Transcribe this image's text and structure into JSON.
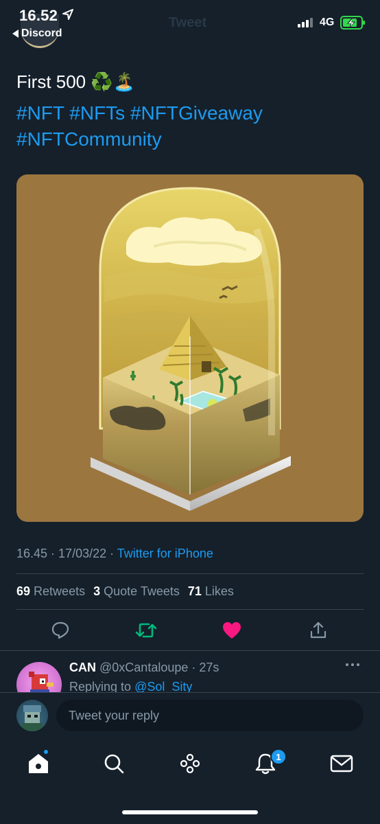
{
  "status_bar": {
    "time": "16.52",
    "back_app": "Discord",
    "ghost_title": "Tweet",
    "network": "4G"
  },
  "tweet": {
    "text": "First 500 ♻️🏝️",
    "hashtags": "#NFT #NFTs #NFTGiveaway #NFTCommunity",
    "time": "16.45",
    "date": "17/03/22",
    "source": "Twitter for iPhone"
  },
  "stats": {
    "retweets_count": "69",
    "retweets_label": "Retweets",
    "quotes_count": "3",
    "quotes_label": "Quote Tweets",
    "likes_count": "71",
    "likes_label": "Likes"
  },
  "actions": {
    "reply_icon": "speech-bubble-icon",
    "retweet_icon": "retweet-icon",
    "like_icon": "heart-icon",
    "share_icon": "share-icon"
  },
  "reply": {
    "name": "CAN",
    "handle": "@0xCantaloupe",
    "age": "27s",
    "replying_prefix": "Replying to",
    "replying_to": "@Sol_Sity"
  },
  "composer": {
    "placeholder": "Tweet your reply"
  },
  "tabbar": {
    "notification_count": "1"
  },
  "colors": {
    "background": "#15202b",
    "accent": "#1d9bf0",
    "muted": "#8899a6",
    "retweet_active": "#00ba7c",
    "like_active": "#f91880",
    "image_bg": "#9c763f"
  }
}
